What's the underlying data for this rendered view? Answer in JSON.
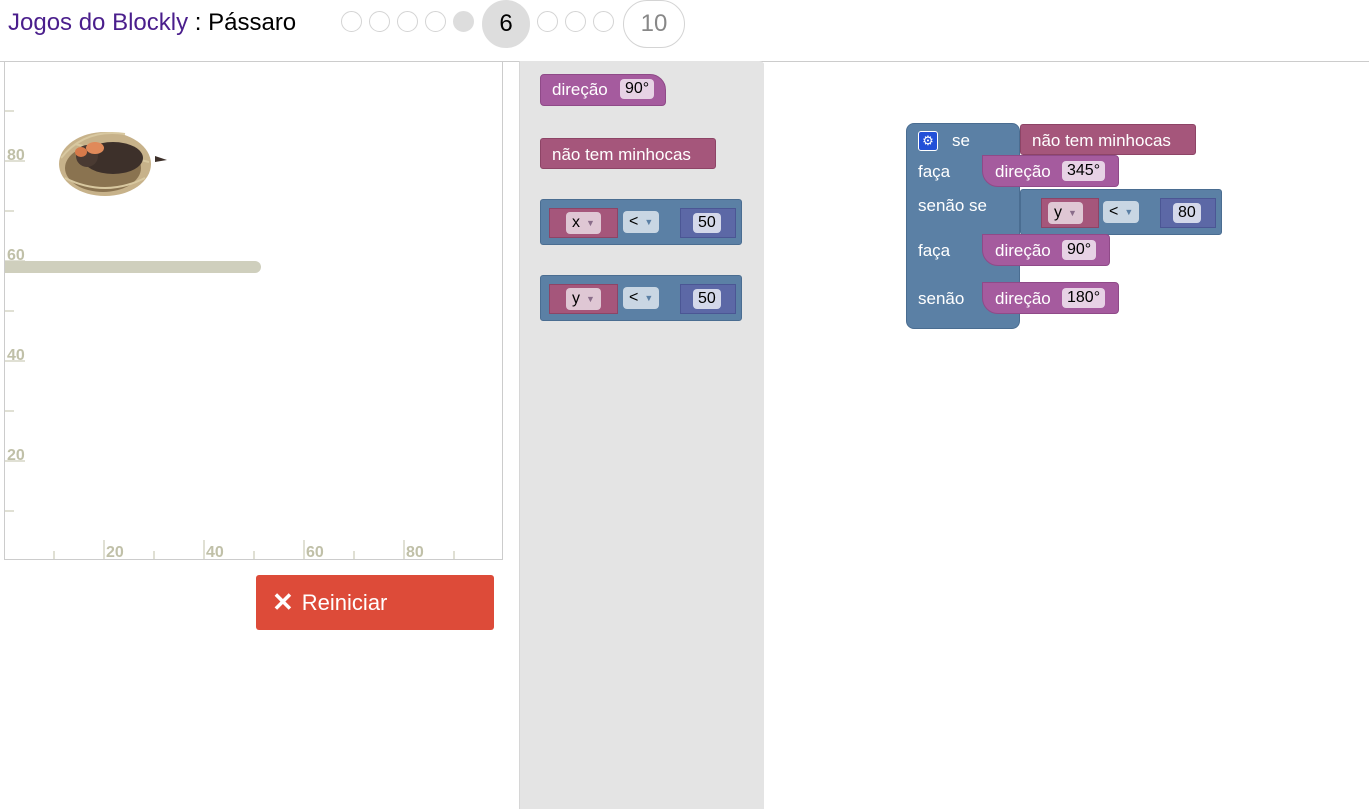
{
  "header": {
    "app_link": "Jogos do Blockly",
    "separator": " : ",
    "game": "Pássaro",
    "levels": [
      {
        "label": "",
        "state": "normal"
      },
      {
        "label": "",
        "state": "normal"
      },
      {
        "label": "",
        "state": "normal"
      },
      {
        "label": "",
        "state": "normal"
      },
      {
        "label": "",
        "state": "done"
      },
      {
        "label": "6",
        "state": "current"
      },
      {
        "label": "",
        "state": "normal"
      },
      {
        "label": "",
        "state": "normal"
      },
      {
        "label": "",
        "state": "normal"
      },
      {
        "label": "10",
        "state": "last"
      }
    ]
  },
  "canvas": {
    "x_ticks": [
      "20",
      "40",
      "60",
      "80"
    ],
    "y_ticks": [
      "80",
      "60",
      "40",
      "20"
    ],
    "wall": {
      "x_from": 0,
      "x_to": 50,
      "y": 59
    },
    "nest_label": "nest-with-bird"
  },
  "reset_button": {
    "icon": "close-icon",
    "label": "Reiniciar"
  },
  "toolbox": {
    "heading_block": {
      "label": "direção",
      "value": "90°"
    },
    "no_worm_block": {
      "label": "não tem minhocas"
    },
    "compare_x": {
      "var": "x",
      "op": "<",
      "value": "50"
    },
    "compare_y": {
      "var": "y",
      "op": "<",
      "value": "50"
    }
  },
  "workspace": {
    "if_block": {
      "if_label": "se",
      "condition": "não tem minhocas",
      "do_label": "faça",
      "do_heading": {
        "label": "direção",
        "value": "345°"
      },
      "elseif_label": "senão se",
      "elseif_condition": {
        "var": "y",
        "op": "<",
        "value": "80"
      },
      "do2_label": "faça",
      "do2_heading": {
        "label": "direção",
        "value": "90°"
      },
      "else_label": "senão",
      "else_heading": {
        "label": "direção",
        "value": "180°"
      }
    }
  },
  "colors": {
    "heading_block": "#a55b9e",
    "condition_block": "#a5567b",
    "logic_block": "#5b80a5",
    "math_block": "#5c68a6",
    "reset_button": "#dd4b39",
    "toolbox_bg": "#e4e4e4"
  }
}
